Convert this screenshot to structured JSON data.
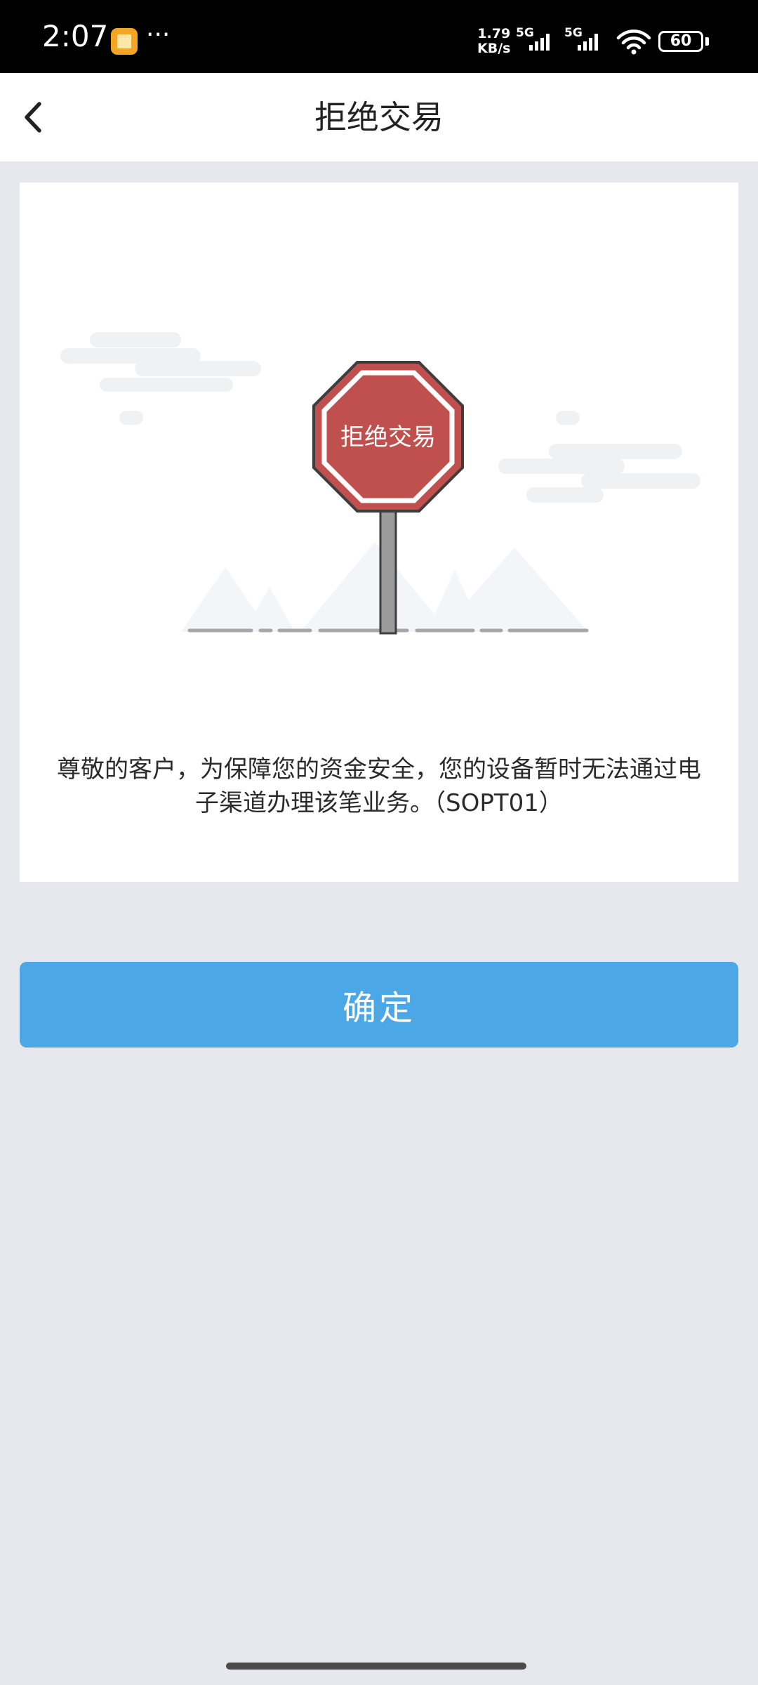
{
  "status_bar": {
    "time": "2:07",
    "dots": "···",
    "speed_value": "1.79",
    "speed_unit": "KB/s",
    "network_1": "5G",
    "network_2": "5G",
    "battery": "60"
  },
  "nav": {
    "title": "拒绝交易"
  },
  "sign": {
    "text": "拒绝交易",
    "color": "#c0504d"
  },
  "message": {
    "text": "尊敬的客户，为保障您的资金安全，您的设备暂时无法通过电子渠道办理该笔业务。（SOPT01）"
  },
  "confirm_button": {
    "label": "确定",
    "color": "#4ca7e7"
  },
  "icons": {
    "back": "chevron-left-icon",
    "signal": "signal-icon",
    "wifi": "wifi-icon",
    "battery": "battery-icon",
    "app": "notification-app-icon"
  }
}
